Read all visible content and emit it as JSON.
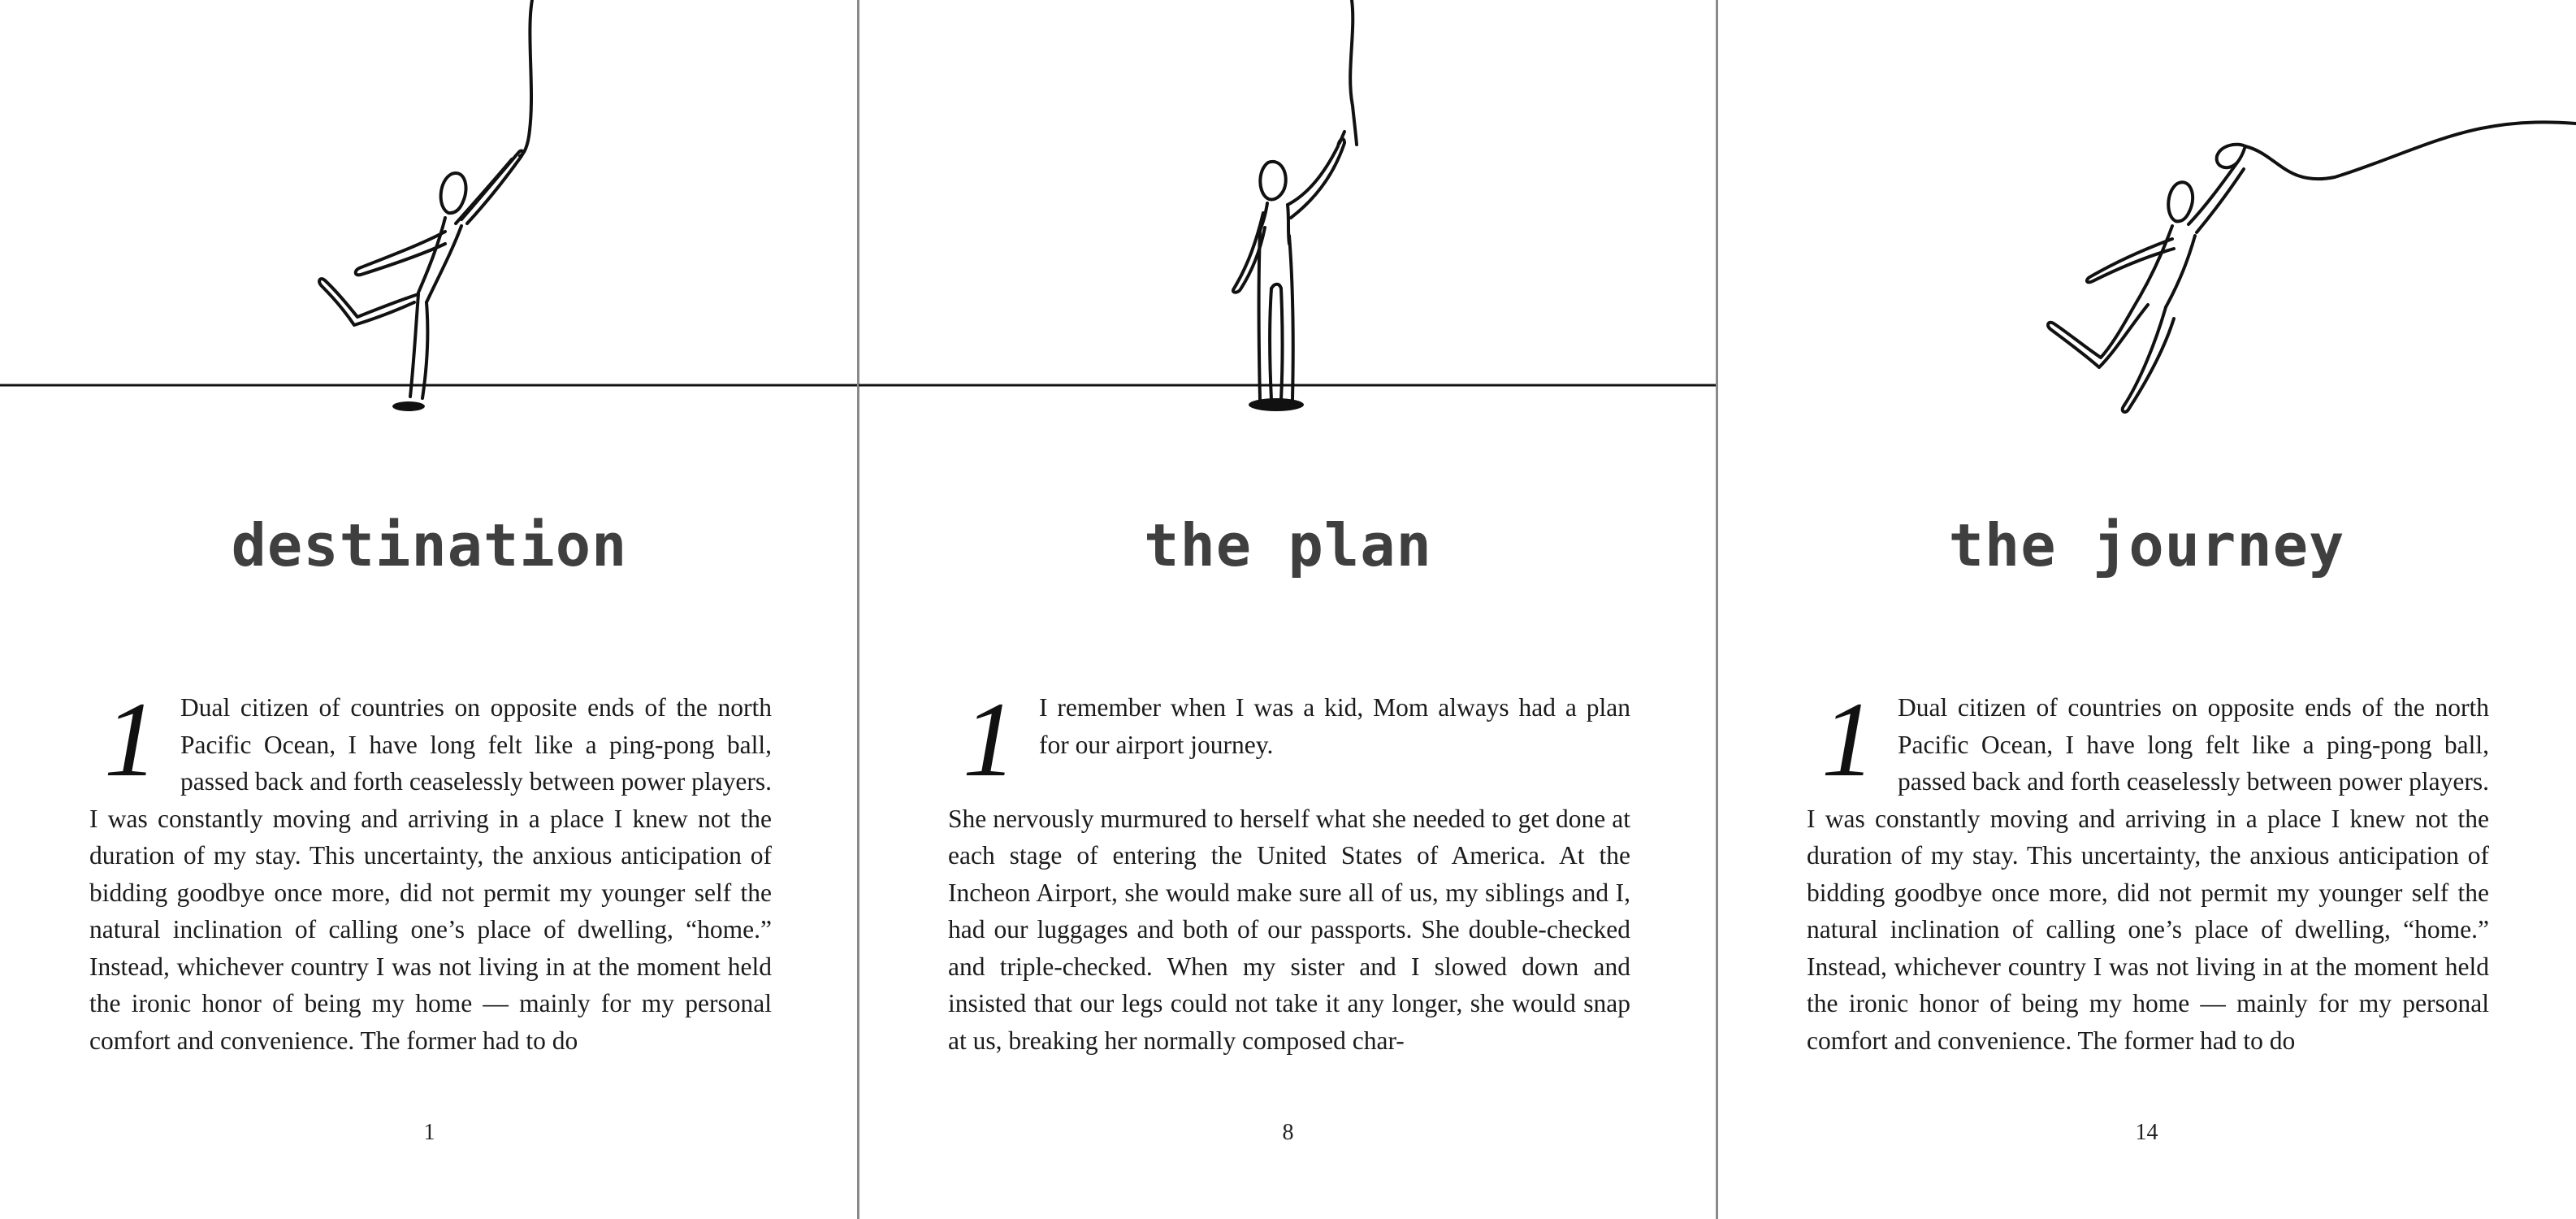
{
  "pages": [
    {
      "title": "destination",
      "chapter_number": "1",
      "paragraphs": [
        "Dual citizen of countries on opposite ends of the north Pacific Ocean, I have long felt like a ping-pong ball, passed back and forth ceaselessly between power players. I was constantly moving and arriving in a place I knew not the duration of my stay. This uncertainty, the anxious anticipation of bidding goodbye once more, did not permit my younger self the natural inclination of calling one’s place of dwelling, “home.” Instead, whichever country I was not living in at the moment held the ironic honor of being my home — mainly for my personal comfort and convenience. The former had to do"
      ],
      "page_number": "1"
    },
    {
      "title": "the plan",
      "chapter_number": "1",
      "paragraphs": [
        "I remember when I was a kid, Mom always had a plan for our airport journey.",
        "She nervously murmured to herself what she needed to get done at each stage of entering the United States of America. At the Incheon Airport, she would make sure all of us, my siblings and I, had our luggages and both of our passports. She double-checked and triple-checked. When my sister and I slowed down and insisted that our legs could not take it any longer, she would snap at us, breaking her normally composed char-"
      ],
      "page_number": "8"
    },
    {
      "title": "the journey",
      "chapter_number": "1",
      "paragraphs": [
        "Dual citizen of countries on opposite ends of the north Pacific Ocean, I have long felt like a ping-pong ball, passed back and forth ceaselessly between power players. I was constantly moving and arriving in a place I knew not the duration of my stay. This uncertainty, the anxious anticipation of bidding goodbye once more, did not permit my younger self the natural inclination of calling one’s place of dwelling, “home.” Instead, whichever country I was not living in at the moment held the ironic honor of being my home — mainly for my personal comfort and convenience. The former had to do"
      ],
      "page_number": "14"
    }
  ],
  "colors": {
    "title": "#3f3f3f",
    "text": "#1b1b1b",
    "divider": "#8a8a8a",
    "line_art": "#111111"
  },
  "icons": [
    "figure-kicking-icon",
    "figure-reaching-icon",
    "figure-floating-icon"
  ]
}
